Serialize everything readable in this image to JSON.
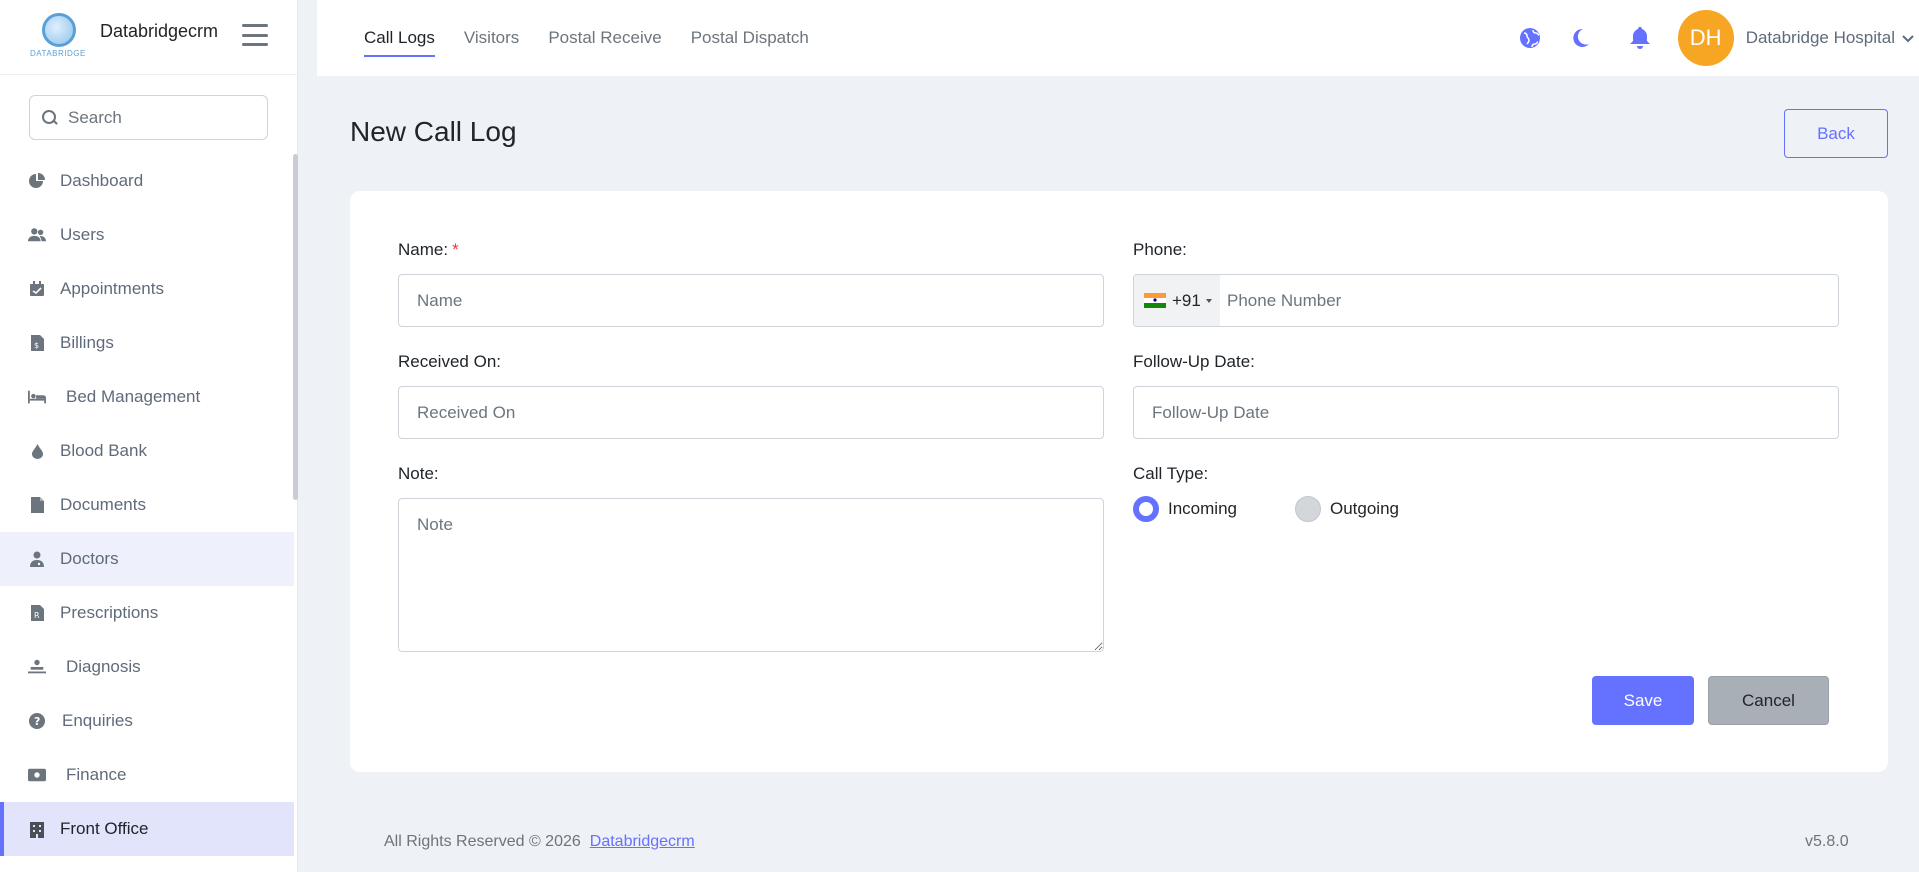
{
  "brand": {
    "name": "Databridgecrm",
    "logo_text": "DATABRIDGE"
  },
  "sidebar": {
    "search_placeholder": "Search",
    "items": [
      {
        "label": "Dashboard",
        "icon": "pie-chart-icon"
      },
      {
        "label": "Users",
        "icon": "users-icon"
      },
      {
        "label": "Appointments",
        "icon": "calendar-check-icon"
      },
      {
        "label": "Billings",
        "icon": "file-invoice-icon"
      },
      {
        "label": "Bed Management",
        "icon": "bed-icon"
      },
      {
        "label": "Blood Bank",
        "icon": "drop-icon"
      },
      {
        "label": "Documents",
        "icon": "file-icon"
      },
      {
        "label": "Doctors",
        "icon": "doctor-icon"
      },
      {
        "label": "Prescriptions",
        "icon": "prescription-icon"
      },
      {
        "label": "Diagnosis",
        "icon": "diagnosis-icon"
      },
      {
        "label": "Enquiries",
        "icon": "question-icon"
      },
      {
        "label": "Finance",
        "icon": "money-icon"
      },
      {
        "label": "Front Office",
        "icon": "building-icon"
      }
    ]
  },
  "topbar": {
    "tabs": [
      "Call Logs",
      "Visitors",
      "Postal Receive",
      "Postal Dispatch"
    ],
    "avatar_initials": "DH",
    "user_name": "Databridge Hospital"
  },
  "page": {
    "title": "New Call Log",
    "back_label": "Back"
  },
  "form": {
    "name_label": "Name:",
    "required_mark": "*",
    "name_placeholder": "Name",
    "phone_label": "Phone:",
    "country_code": "+91",
    "phone_placeholder": "Phone Number",
    "received_label": "Received On:",
    "received_placeholder": "Received On",
    "followup_label": "Follow-Up Date:",
    "followup_placeholder": "Follow-Up Date",
    "note_label": "Note:",
    "note_placeholder": "Note",
    "call_type_label": "Call Type:",
    "call_type_options": [
      "Incoming",
      "Outgoing"
    ],
    "call_type_selected": "Incoming",
    "save_label": "Save",
    "cancel_label": "Cancel"
  },
  "footer": {
    "text": "All Rights Reserved © 2026",
    "link": "Databridgecrm",
    "version": "v5.8.0"
  },
  "colors": {
    "accent": "#6571ff",
    "avatar": "#f6a623",
    "required": "#e63946"
  }
}
